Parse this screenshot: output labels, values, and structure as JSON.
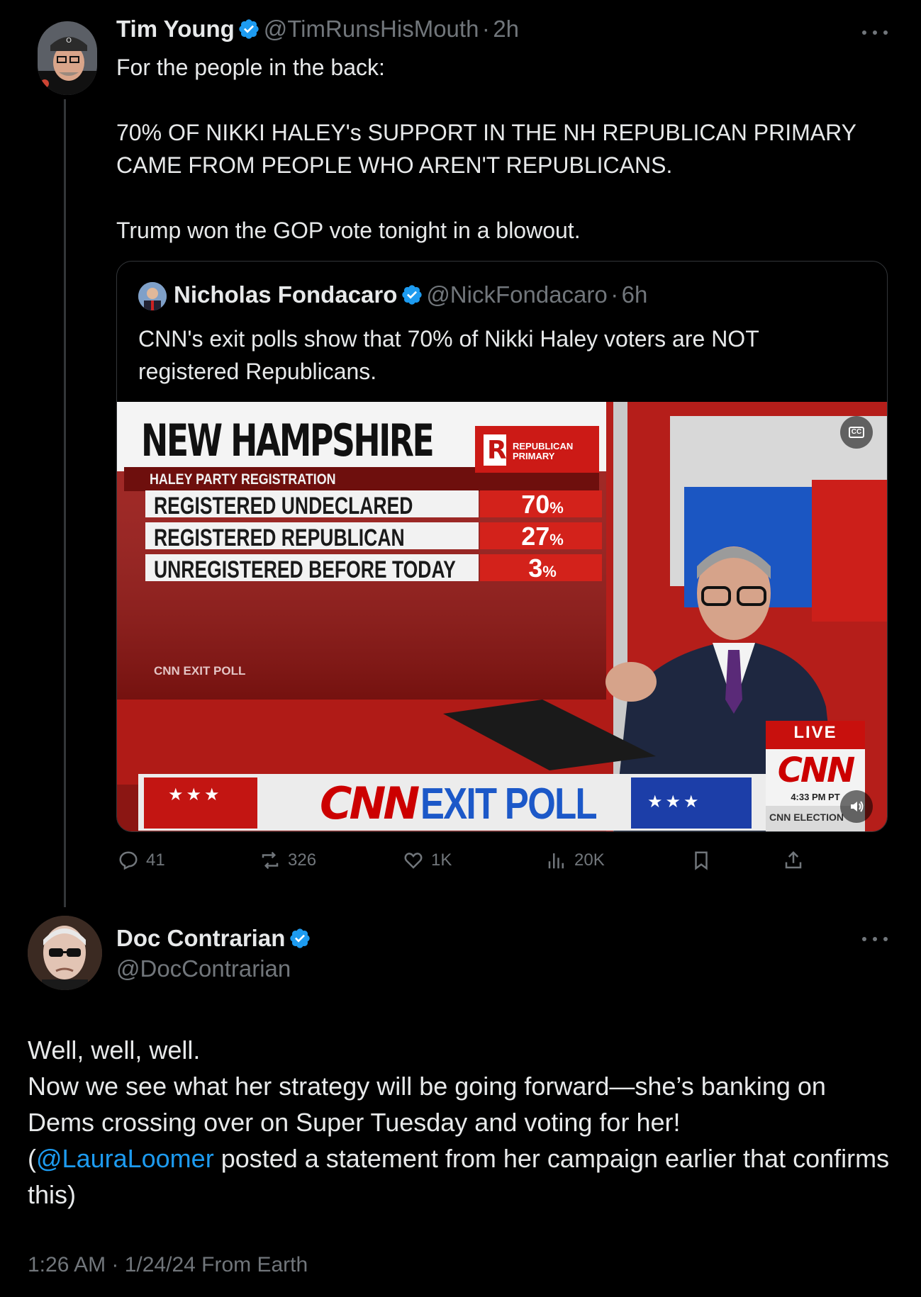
{
  "parent_tweet": {
    "author_name": "Tim Young",
    "handle": "@TimRunsHisMouth",
    "separator": "·",
    "time": "2h",
    "text": "For the people in the back:\n\n70% OF NIKKI HALEY's SUPPORT IN THE NH REPUBLICAN PRIMARY CAME FROM PEOPLE WHO AREN'T REPUBLICANS.\n\nTrump won the GOP vote tonight in a blowout."
  },
  "quoted_tweet": {
    "author_name": "Nicholas Fondacaro",
    "handle": "@NickFondacaro",
    "separator": "·",
    "time": "6h",
    "text": "CNN's exit polls show that 70% of Nikki Haley voters are NOT registered Republicans."
  },
  "media": {
    "headline": "NEW HAMPSHIRE",
    "party_letter": "R",
    "party_label_1": "REPUBLICAN",
    "party_label_2": "PRIMARY",
    "subheader": "HALEY PARTY REGISTRATION",
    "rows": [
      {
        "label": "REGISTERED UNDECLARED",
        "value": "70",
        "unit": "%"
      },
      {
        "label": "REGISTERED REPUBLICAN",
        "value": "27",
        "unit": "%"
      },
      {
        "label": "UNREGISTERED BEFORE TODAY",
        "value": "3",
        "unit": "%"
      }
    ],
    "source_label": "CNN EXIT POLL",
    "bottom_logo": "CNN",
    "bottom_title": "EXIT POLL",
    "live_label": "LIVE",
    "corner_logo": "CNN",
    "clock": "4:33 PM PT",
    "corner_caption": "CNN ELECTION",
    "cc_label": "CC",
    "colors": {
      "cnn_red": "#cc0000",
      "panel_bg": "#7a1210",
      "blue": "#1c58c8"
    }
  },
  "actions": {
    "replies": "41",
    "reposts": "326",
    "likes": "1K",
    "views": "20K"
  },
  "reply_tweet": {
    "author_name": "Doc Contrarian",
    "handle": "@DocContrarian",
    "line1": "Well, well, well.",
    "line2": "Now we see what her strategy will be going forward—she’s banking on Dems crossing over on Super Tuesday and voting for her!",
    "line3_open": "(",
    "mention": "@LauraLoomer",
    "line3_rest": " posted a statement from her campaign earlier that confirms this)",
    "footer": "1:26 AM · 1/24/24 From Earth"
  },
  "colors": {
    "background": "#000000",
    "text_primary": "#e7e9ea",
    "text_secondary": "#71767b",
    "accent": "#1d9bf0",
    "border": "#333639"
  }
}
